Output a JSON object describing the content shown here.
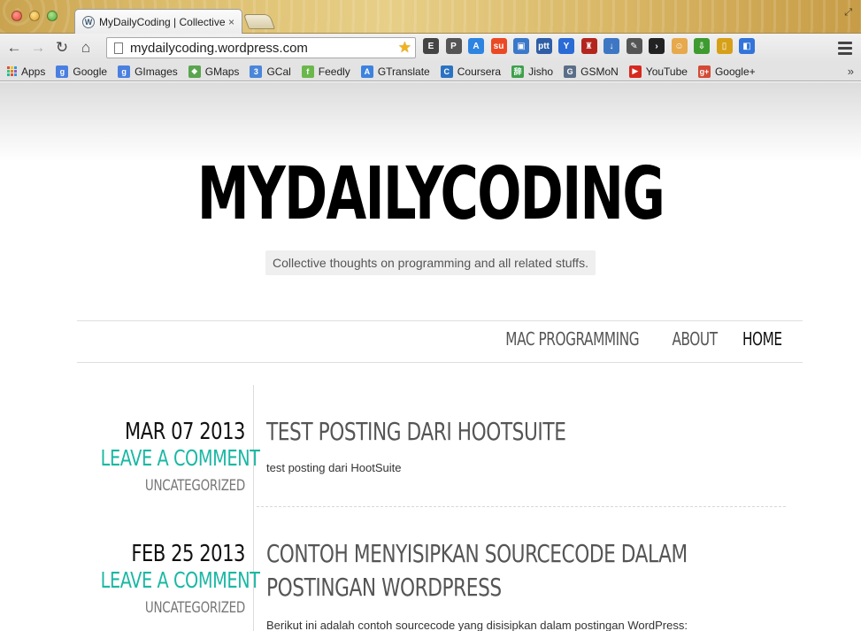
{
  "browser": {
    "tab_title": "MyDailyCoding | Collective",
    "tab_close": "×",
    "url": "mydailycoding.wordpress.com",
    "nav": {
      "back": "←",
      "forward": "→",
      "reload": "↻",
      "home": "⌂"
    },
    "star": "★",
    "extensions": [
      {
        "name": "evernote-icon",
        "glyph": "E",
        "color": "#444"
      },
      {
        "name": "pin-icon",
        "glyph": "P",
        "color": "#555"
      },
      {
        "name": "translate-icon",
        "glyph": "A",
        "color": "#2e84e1"
      },
      {
        "name": "stumbleupon-icon",
        "glyph": "su",
        "color": "#eb4924"
      },
      {
        "name": "screen-icon",
        "glyph": "▣",
        "color": "#3a78c9"
      },
      {
        "name": "ptt-icon",
        "glyph": "ptt",
        "color": "#2f5ea6"
      },
      {
        "name": "y-icon",
        "glyph": "Y",
        "color": "#2a6bd6"
      },
      {
        "name": "sofa-icon",
        "glyph": "♜",
        "color": "#b3261e"
      },
      {
        "name": "download-arrow-icon",
        "glyph": "↓",
        "color": "#3d77c4"
      },
      {
        "name": "pencil-icon",
        "glyph": "✎",
        "color": "#555"
      },
      {
        "name": "plex-icon",
        "glyph": "›",
        "color": "#222"
      },
      {
        "name": "face-icon",
        "glyph": "☺",
        "color": "#e6a94d"
      },
      {
        "name": "green-download-icon",
        "glyph": "⇩",
        "color": "#3e9b2f"
      },
      {
        "name": "phone-icon",
        "glyph": "▯",
        "color": "#d6a019"
      },
      {
        "name": "delicious-icon",
        "glyph": "◧",
        "color": "#3274d9"
      }
    ],
    "bookmarks": [
      {
        "label": "Apps",
        "icon": "apps-icon",
        "color": ""
      },
      {
        "label": "Google",
        "icon": "google-icon",
        "glyph": "g",
        "color": "#4a7fe0"
      },
      {
        "label": "GImages",
        "icon": "google-images-icon",
        "glyph": "g",
        "color": "#4a7fe0"
      },
      {
        "label": "GMaps",
        "icon": "maps-icon",
        "glyph": "◆",
        "color": "#5aa54f"
      },
      {
        "label": "GCal",
        "icon": "calendar-icon",
        "glyph": "3",
        "color": "#4a86d9"
      },
      {
        "label": "Feedly",
        "icon": "feedly-icon",
        "glyph": "f",
        "color": "#6bb84a"
      },
      {
        "label": "GTranslate",
        "icon": "translate-icon",
        "glyph": "A",
        "color": "#3d82df"
      },
      {
        "label": "Coursera",
        "icon": "coursera-icon",
        "glyph": "C",
        "color": "#2a73c2"
      },
      {
        "label": "Jisho",
        "icon": "jisho-icon",
        "glyph": "辞",
        "color": "#3ea04c"
      },
      {
        "label": "GSMoN",
        "icon": "gsmon-icon",
        "glyph": "G",
        "color": "#5b6e88"
      },
      {
        "label": "YouTube",
        "icon": "youtube-icon",
        "glyph": "▶",
        "color": "#d6281f"
      },
      {
        "label": "Google+",
        "icon": "google-plus-icon",
        "glyph": "g+",
        "color": "#d44a36"
      }
    ],
    "bookmarks_more": "»"
  },
  "site": {
    "title": "MYDAILYCODING",
    "tagline": "Collective thoughts on programming and all related stuffs.",
    "menu": [
      {
        "label": "MAC PROGRAMMING",
        "current": false
      },
      {
        "label": "ABOUT",
        "current": false
      },
      {
        "label": "HOME",
        "current": true
      }
    ]
  },
  "posts": [
    {
      "date": "MAR 07 2013",
      "comment_link": "LEAVE A COMMENT",
      "category": "UNCATEGORIZED",
      "title": "TEST POSTING DARI HOOTSUITE",
      "excerpt": "test posting dari HootSuite"
    },
    {
      "date": "FEB 25 2013",
      "comment_link": "LEAVE A COMMENT",
      "category": "UNCATEGORIZED",
      "title": "CONTOH MENYISIPKAN SOURCECODE DALAM POSTINGAN WORDPRESS",
      "excerpt": "Berikut ini adalah contoh sourcecode yang disisipkan dalam postingan WordPress:"
    }
  ]
}
